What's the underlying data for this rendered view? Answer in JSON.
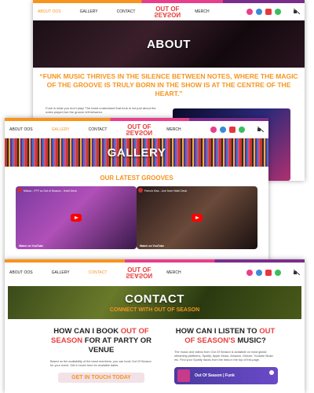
{
  "nav": {
    "about": "About OOS",
    "gallery": "Gallery",
    "contact": "Contact",
    "logo_line1": "OUT OF",
    "logo_line2": "SEASON",
    "merch": "Merch"
  },
  "about_page": {
    "hero_title": "ABOUT",
    "quote": "“FUNK MUSIC THRIVES IN THE SILENCE BETWEEN NOTES, WHERE THE MAGIC OF THE GROOVE IS TRULY BORN IN THE SHOW IS AT THE CENTRE OF THE HEART.”",
    "body": "Funk is what you don't play! The band understand that funk is not just about the notes played but the groove left between."
  },
  "gallery_page": {
    "hero_title": "GALLERY",
    "section_title": "OUR LATEST GROOVES",
    "videos": [
      {
        "title": "Mitoxo - FFF vs Out of Season - Hotel Deck",
        "share": "Watch on",
        "brand": "YouTube"
      },
      {
        "title": "French Kiss - Live from Hotel Deck",
        "share": "Watch on",
        "brand": "YouTube"
      }
    ]
  },
  "contact_page": {
    "hero_title": "CONTACT",
    "hero_subtitle": "CONNECT WITH OUT OF SEASON",
    "book": {
      "heading_a": "HOW CAN I BOOK ",
      "heading_hl": "OUT OF SEASON",
      "heading_b": " FOR AT PARTY OR VENUE",
      "body": "Based on the availability of the band members, you can book Out Of Season for your event. Get in touch here for available dates.",
      "cta": "GET IN TOUCH TODAY"
    },
    "listen": {
      "heading_a": "HOW CAN I LISTEN TO ",
      "heading_hl": "OUT OF SEASON'S",
      "heading_b": " MUSIC?",
      "body": "The music and videos from Out Of Season is available on most global streaming platforms, Spotify, Apple Music, Amazon, Deezer, Youtube Music etc. Find your Spotify tracks from the links in the top of this page.",
      "embed_title": "Out Of Season | Funk"
    }
  },
  "colors": {
    "accent_orange": "#f7941d",
    "accent_red": "#e83e3e",
    "accent_pink": "#e83e8c"
  },
  "icons": [
    "instagram-icon",
    "facebook-icon",
    "youtube-icon",
    "spotify-icon",
    "mute-icon"
  ]
}
